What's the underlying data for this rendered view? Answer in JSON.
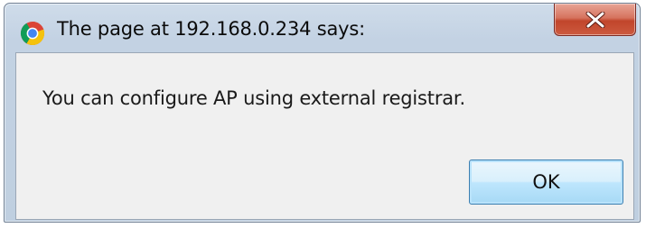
{
  "dialog": {
    "title": "The page at 192.168.0.234 says:",
    "message": "You can configure AP using external registrar.",
    "ok_label": "OK",
    "close_icon": "close-icon",
    "app_icon": "chrome-icon"
  },
  "colors": {
    "close_button": "#c1452b",
    "ok_button_border": "#3c7fb1",
    "content_background": "#f0f0f0",
    "frame_background": "#c3d2e3"
  }
}
